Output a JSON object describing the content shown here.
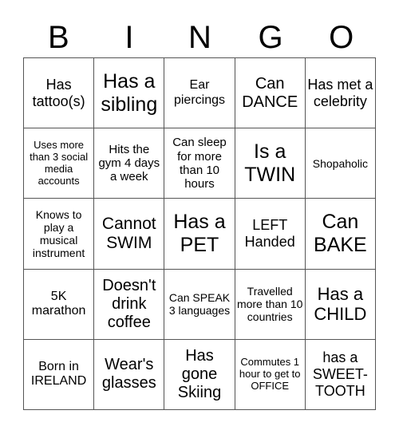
{
  "header": {
    "letters": [
      "B",
      "I",
      "N",
      "G",
      "O"
    ]
  },
  "grid": {
    "rows": [
      [
        "Has tattoo(s)",
        "Has a sibling",
        "Ear piercings",
        "Can DANCE",
        "Has met a celebrity"
      ],
      [
        "Uses more than 3 social media accounts",
        "Hits the gym 4 days a week",
        "Can sleep for more than 10 hours",
        "Is a TWIN",
        "Shopaholic"
      ],
      [
        "Knows to play a musical instrument",
        "Cannot SWIM",
        "Has a PET",
        "LEFT Handed",
        "Can BAKE"
      ],
      [
        "5K marathon",
        "Doesn't drink coffee",
        "Can SPEAK 3 languages",
        "Travelled more than 10 countries",
        "Has a CHILD"
      ],
      [
        "Born in IRELAND",
        "Wear's glasses",
        "Has gone Skiing",
        "Commutes 1 hour to get to OFFICE",
        "has a SWEET-TOOTH"
      ]
    ]
  }
}
